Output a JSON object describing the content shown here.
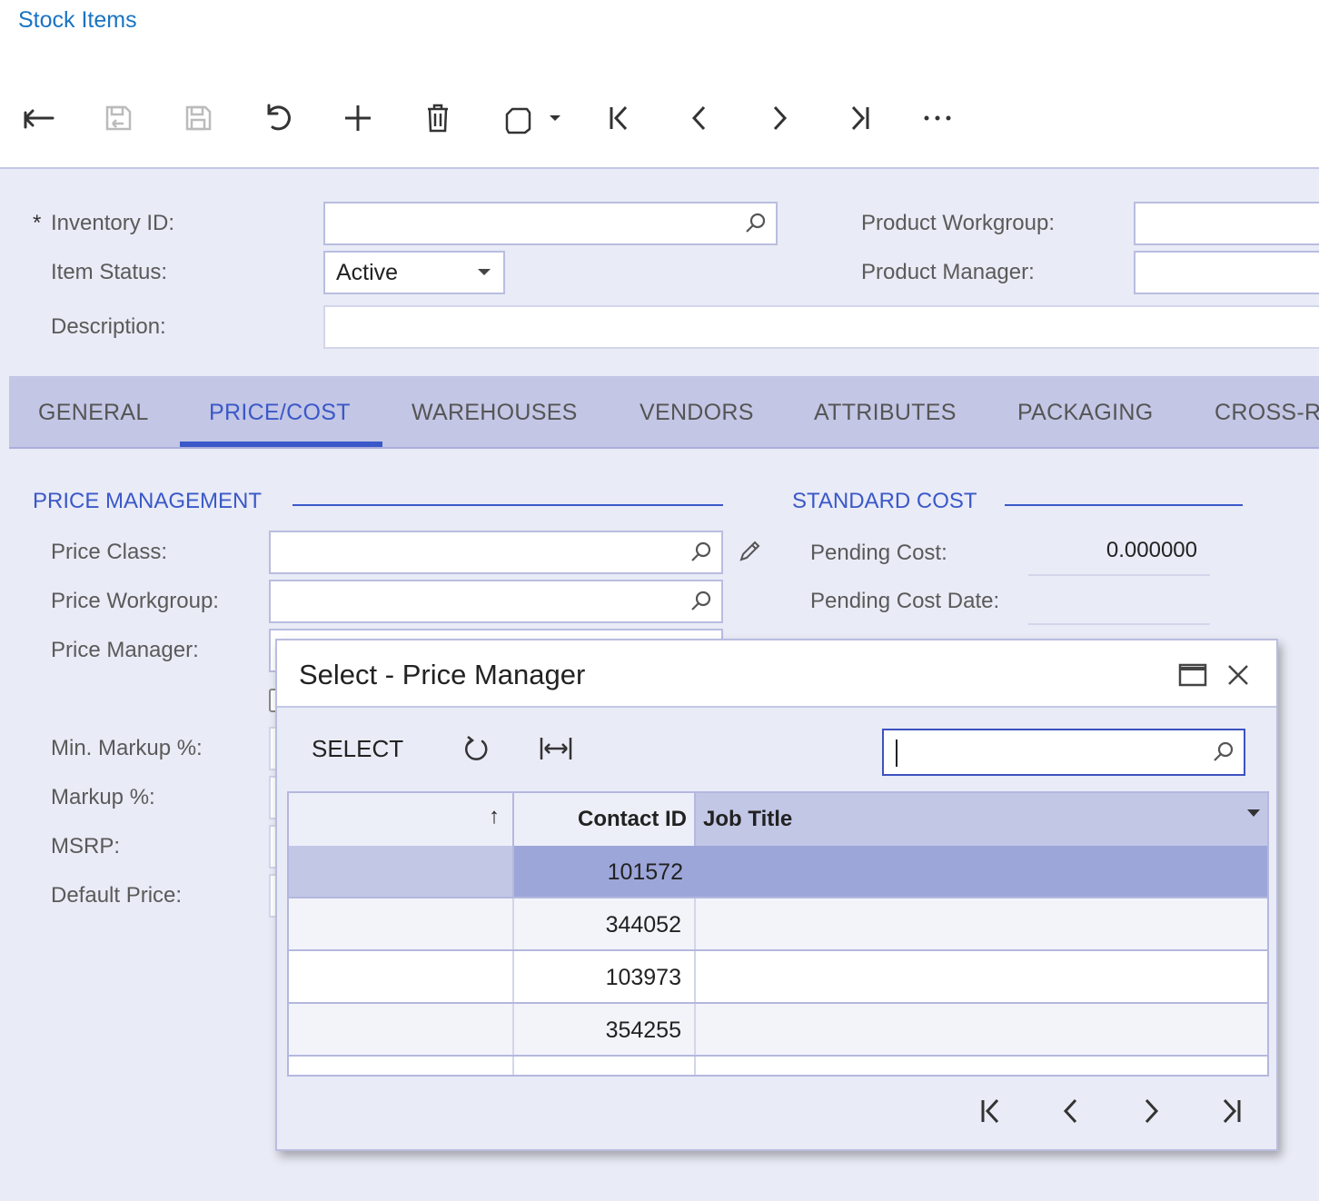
{
  "page": {
    "title": "Stock Items"
  },
  "toolbar": {
    "icons": [
      "back-icon",
      "save-close-icon",
      "save-icon",
      "undo-icon",
      "add-icon",
      "delete-icon",
      "clipboard-icon",
      "first-record-icon",
      "previous-record-icon",
      "next-record-icon",
      "last-record-icon",
      "more-icon"
    ]
  },
  "form": {
    "required_marker": "*",
    "inventory_id": {
      "label": "Inventory ID:",
      "value": ""
    },
    "item_status": {
      "label": "Item Status:",
      "value": "Active"
    },
    "description": {
      "label": "Description:",
      "value": ""
    },
    "product_workgroup": {
      "label": "Product Workgroup:",
      "value": ""
    },
    "product_manager": {
      "label": "Product Manager:",
      "value": ""
    }
  },
  "tabs": [
    {
      "label": "GENERAL",
      "active": false
    },
    {
      "label": "PRICE/COST",
      "active": true
    },
    {
      "label": "WAREHOUSES",
      "active": false
    },
    {
      "label": "VENDORS",
      "active": false
    },
    {
      "label": "ATTRIBUTES",
      "active": false
    },
    {
      "label": "PACKAGING",
      "active": false
    },
    {
      "label": "CROSS-R",
      "active": false
    }
  ],
  "price_management": {
    "title": "PRICE MANAGEMENT",
    "price_class_label": "Price Class:",
    "price_workgroup_label": "Price Workgroup:",
    "price_manager_label": "Price Manager:",
    "min_markup_label": "Min. Markup %:",
    "markup_label": "Markup %:",
    "msrp_label": "MSRP:",
    "default_price_label": "Default Price:"
  },
  "standard_cost": {
    "title": "STANDARD COST",
    "pending_cost_label": "Pending Cost:",
    "pending_cost_value": "0.000000",
    "pending_cost_date_label": "Pending Cost Date:",
    "pending_cost_date_value": ""
  },
  "dialog": {
    "title": "Select - Price Manager",
    "select_button": "SELECT",
    "search_value": "",
    "columns": {
      "sort_indicator": "↑",
      "contact_id": "Contact ID",
      "job_title": "Job Title"
    },
    "rows": [
      {
        "contact_id": "101572",
        "job_title": "",
        "selected": true
      },
      {
        "contact_id": "344052",
        "job_title": "",
        "selected": false
      },
      {
        "contact_id": "103973",
        "job_title": "",
        "selected": false
      },
      {
        "contact_id": "354255",
        "job_title": "",
        "selected": false
      }
    ]
  },
  "colors": {
    "accent": "#3a58c8",
    "link": "#1a74c2",
    "background": "#e9ebf6",
    "tab_bar": "#c3c6e5",
    "selected_row": "#9da6d9",
    "header_selected": "#c3c7e6"
  }
}
